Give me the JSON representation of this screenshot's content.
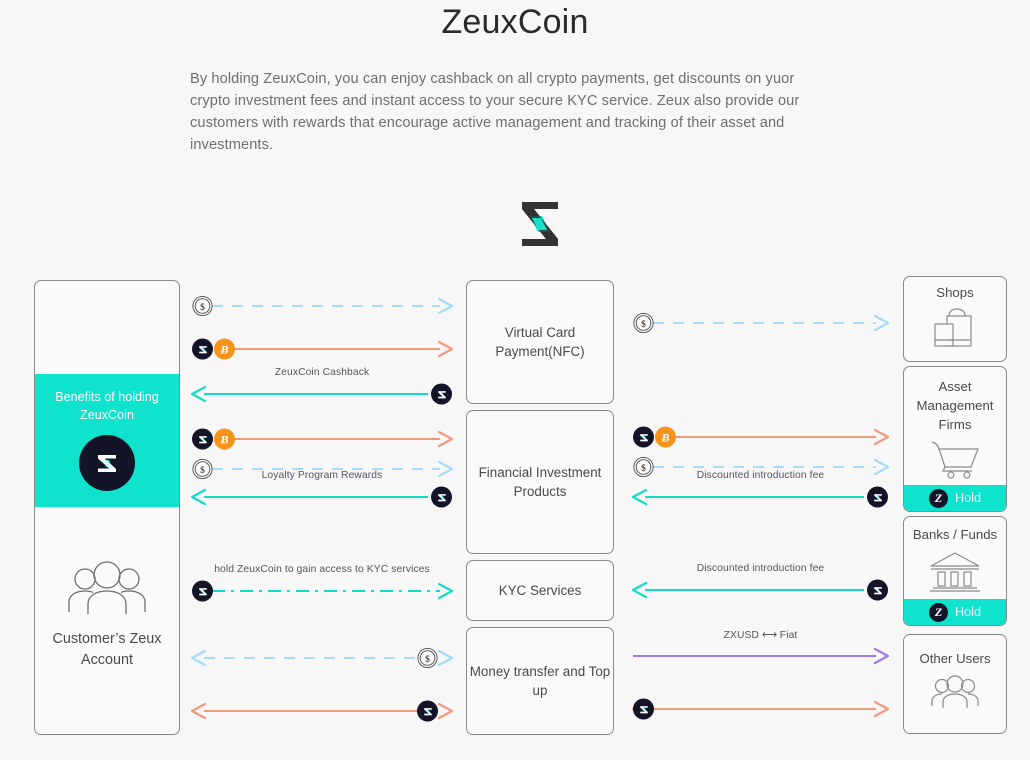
{
  "header": {
    "title": "ZeuxCoin",
    "intro": "By holding ZeuxCoin,  you can enjoy cashback on all crypto payments,  get discounts on yuor crypto investment fees and instant access to your secure KYC service.  Zeux also provide our customers with rewards that encourage active management and tracking of their asset and investments."
  },
  "brand": {
    "logo_icon": "zeux-z-logo"
  },
  "colors": {
    "teal": "#0fe3cd",
    "teal_arrow": "#13dcc6",
    "orange_arrow": "#f2997a",
    "blue_arrow": "#a8dcf5",
    "purple_arrow": "#9b7ee0",
    "coin_dark": "#141428",
    "bitcoin_orange": "#f7931a",
    "background": "#f7f7f8",
    "box_border": "#8a8a8a"
  },
  "customer": {
    "benefits_label": "Benefits of holding ZeuxCoin",
    "benefits_icon": "zeuxcoin-icon",
    "account_icon": "users-group-icon",
    "account_label": "Customer’s Zeux Account"
  },
  "services": [
    {
      "id": "virtual-card",
      "label": "Virtual Card Payment(NFC)"
    },
    {
      "id": "financial-investment",
      "label": "Financial Investment Products"
    },
    {
      "id": "kyc-services",
      "label": "KYC Services"
    },
    {
      "id": "money-transfer",
      "label": "Money transfer and Top up"
    }
  ],
  "parties": [
    {
      "id": "shops",
      "title": "Shops",
      "icon": "shopping-bags-icon",
      "hold": null
    },
    {
      "id": "asset-management-firms",
      "title": "Asset Management Firms",
      "icon": "shopping-cart-icon",
      "hold": "Hold",
      "hold_icon": "zeuxcoin-icon"
    },
    {
      "id": "banks-funds",
      "title": "Banks  / Funds",
      "icon": "bank-building-icon",
      "hold": "Hold",
      "hold_icon": "zeuxcoin-icon"
    },
    {
      "id": "other-users",
      "title": "Other Users",
      "icon": "users-group-icon",
      "hold": null
    }
  ],
  "flows_left": [
    {
      "id": "card-fiat-out",
      "label": "",
      "style": "dashed",
      "color": "#a8dcf5",
      "dir": "right",
      "start_coins": [
        "usd"
      ],
      "end_coins": []
    },
    {
      "id": "card-crypto-out",
      "label": "",
      "style": "solid",
      "color": "#f2997a",
      "dir": "right",
      "start_coins": [
        "z",
        "btc"
      ],
      "end_coins": []
    },
    {
      "id": "cashback-in",
      "label": "ZeuxCoin Cashback",
      "style": "solid",
      "color": "#13dcc6",
      "dir": "left",
      "start_coins": [],
      "end_coins": [
        "z"
      ]
    },
    {
      "id": "invest-crypto-out",
      "label": "",
      "style": "solid",
      "color": "#f2997a",
      "dir": "right",
      "start_coins": [
        "z",
        "btc"
      ],
      "end_coins": []
    },
    {
      "id": "invest-fiat-out",
      "label": "",
      "style": "dashed",
      "color": "#a8dcf5",
      "dir": "right",
      "start_coins": [
        "usd"
      ],
      "end_coins": []
    },
    {
      "id": "loyalty-in",
      "label": "Loyalty Program Rewards",
      "style": "solid",
      "color": "#13dcc6",
      "dir": "left",
      "start_coins": [],
      "end_coins": [
        "z"
      ]
    },
    {
      "id": "kyc-access",
      "label": "hold ZeuxCoin to gain access to KYC services",
      "style": "dashdot",
      "color": "#13dcc6",
      "dir": "right",
      "start_coins": [
        "z"
      ],
      "end_coins": []
    },
    {
      "id": "topup-fiat",
      "label": "",
      "style": "dashed",
      "color": "#a8dcf5",
      "dir": "both",
      "start_coins": [],
      "end_coins": [
        "usd"
      ]
    },
    {
      "id": "topup-zeux",
      "label": "",
      "style": "solid",
      "color": "#f2997a",
      "dir": "both",
      "start_coins": [],
      "end_coins": [
        "z"
      ]
    }
  ],
  "flows_right": [
    {
      "id": "shops-fiat",
      "label": "",
      "style": "dashed",
      "color": "#a8dcf5",
      "dir": "right",
      "start_coins": [
        "usd"
      ],
      "end_coins": []
    },
    {
      "id": "asset-crypto",
      "label": "",
      "style": "solid",
      "color": "#f2997a",
      "dir": "right",
      "start_coins": [
        "z",
        "btc"
      ],
      "end_coins": []
    },
    {
      "id": "asset-fiat",
      "label": "",
      "style": "dashed",
      "color": "#a8dcf5",
      "dir": "right",
      "start_coins": [
        "usd"
      ],
      "end_coins": []
    },
    {
      "id": "asset-discount",
      "label": "Discounted introduction fee",
      "style": "solid",
      "color": "#13dcc6",
      "dir": "left",
      "start_coins": [],
      "end_coins": [
        "z"
      ]
    },
    {
      "id": "banks-discount",
      "label": "Discounted introduction fee",
      "style": "solid",
      "color": "#13dcc6",
      "dir": "left",
      "start_coins": [],
      "end_coins": [
        "z"
      ]
    },
    {
      "id": "zxusd-fiat",
      "label": "ZXUSD ⟷ Fiat",
      "style": "solid",
      "color": "#9b7ee0",
      "dir": "right",
      "start_coins": [],
      "end_coins": []
    },
    {
      "id": "other-users-zeux",
      "label": "",
      "style": "solid",
      "color": "#f2997a",
      "dir": "both",
      "start_coins": [
        "z"
      ],
      "end_coins": []
    }
  ]
}
